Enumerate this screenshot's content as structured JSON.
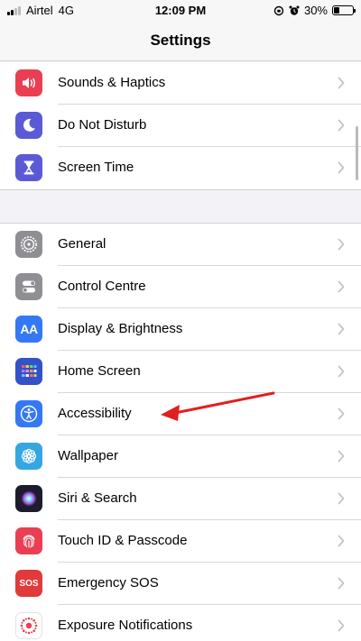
{
  "status_bar": {
    "carrier": "Airtel",
    "network": "4G",
    "time": "12:09 PM",
    "battery_percent": "30%",
    "battery_level": 0.3
  },
  "nav": {
    "title": "Settings"
  },
  "groups": [
    {
      "items": [
        {
          "label": "Sounds & Haptics",
          "icon": "speaker-icon",
          "color": "#ea3e52"
        },
        {
          "label": "Do Not Disturb",
          "icon": "moon-icon",
          "color": "#5b5ad6"
        },
        {
          "label": "Screen Time",
          "icon": "hourglass-icon",
          "color": "#5b5ad6"
        }
      ]
    },
    {
      "items": [
        {
          "label": "General",
          "icon": "gear-icon",
          "color": "#8e8e93"
        },
        {
          "label": "Control Centre",
          "icon": "toggles-icon",
          "color": "#8e8e93"
        },
        {
          "label": "Display & Brightness",
          "icon": "text-size-icon",
          "icon_text": "AA",
          "color": "#3478f6"
        },
        {
          "label": "Home Screen",
          "icon": "app-grid-icon",
          "color": "#3351c9"
        },
        {
          "label": "Accessibility",
          "icon": "accessibility-icon",
          "color": "#3478f6"
        },
        {
          "label": "Wallpaper",
          "icon": "flower-icon",
          "color": "#35a7e0"
        },
        {
          "label": "Siri & Search",
          "icon": "siri-icon",
          "color": "#1c1c2e"
        },
        {
          "label": "Touch ID & Passcode",
          "icon": "fingerprint-icon",
          "color": "#ea3e52"
        },
        {
          "label": "Emergency SOS",
          "icon": "sos-icon",
          "icon_text": "SOS",
          "color": "#e03a3a"
        },
        {
          "label": "Exposure Notifications",
          "icon": "exposure-icon",
          "color": "#ffffff"
        }
      ]
    }
  ],
  "annotation": {
    "color": "#e02020",
    "target": "Accessibility"
  }
}
